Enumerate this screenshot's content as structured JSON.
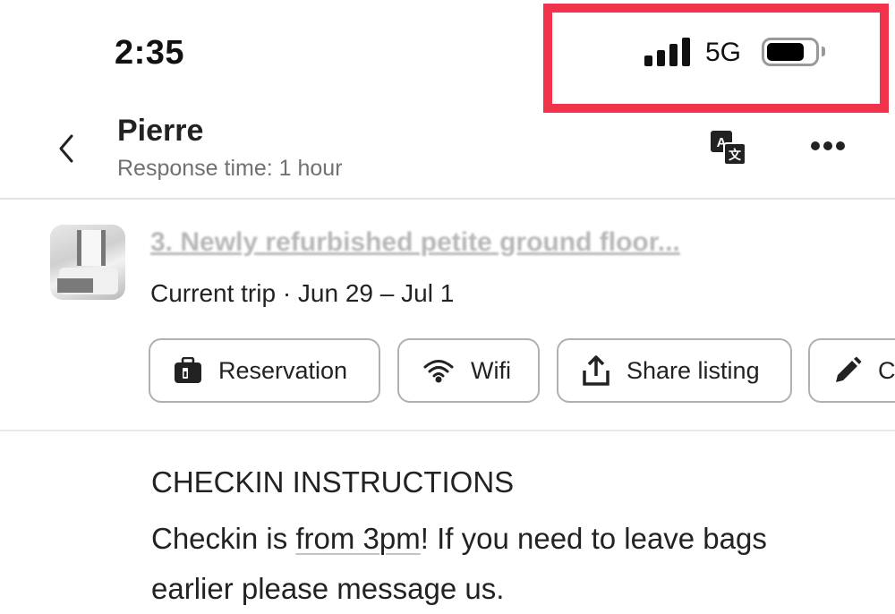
{
  "status_bar": {
    "time": "2:35",
    "network": "5G",
    "signal_bars": 4,
    "battery_level": 0.75
  },
  "annotation": {
    "highlight_color": "#f0324a",
    "highlight_target": "status-bar-indicators"
  },
  "header": {
    "back_icon": "chevron-left-icon",
    "host_name": "Pierre",
    "response_time": "Response time: 1 hour",
    "translate_icon": "translate-icon",
    "more_icon": "more-horizontal-icon"
  },
  "listing": {
    "title": "3. Newly refurbished petite ground floor...",
    "trip": "Current trip · Jun 29 – Jul 1"
  },
  "actions": [
    {
      "label": "Reservation",
      "icon": "suitcase-icon"
    },
    {
      "label": "Wifi",
      "icon": "wifi-icon"
    },
    {
      "label": "Share listing",
      "icon": "share-icon"
    },
    {
      "label": "C",
      "icon": "pencil-icon"
    }
  ],
  "message": {
    "heading": "CHECKIN INSTRUCTIONS",
    "body_before": "Checkin is ",
    "body_link": "from 3pm",
    "body_after": "! If you need to leave bags earlier please message us."
  }
}
